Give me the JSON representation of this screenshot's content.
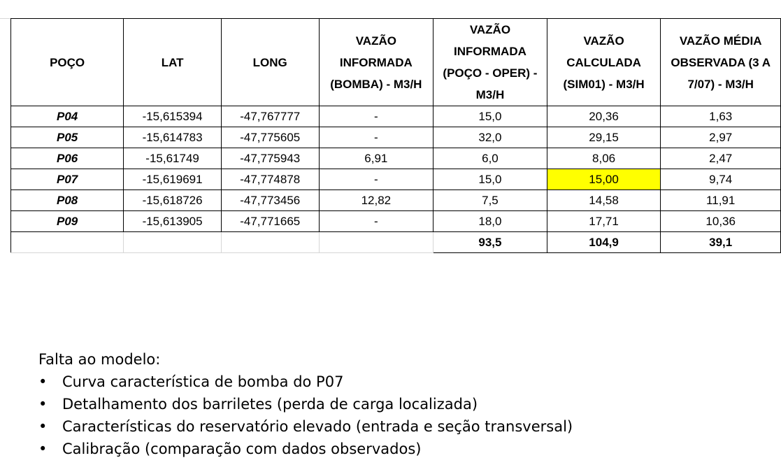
{
  "table": {
    "headers": [
      "POÇO",
      "LAT",
      "LONG",
      "VAZÃO INFORMADA (BOMBA) - M3/H",
      "VAZÃO INFORMADA (POÇO - OPER) - M3/H",
      "VAZÃO CALCULADA (SIM01) - M3/H",
      "VAZÃO MÉDIA OBSERVADA (3 A 7/07) - M3/H"
    ],
    "rows": [
      [
        "P04",
        "-15,615394",
        "-47,767777",
        "-",
        "15,0",
        "20,36",
        "1,63"
      ],
      [
        "P05",
        "-15,614783",
        "-47,775605",
        "-",
        "32,0",
        "29,15",
        "2,97"
      ],
      [
        "P06",
        "-15,61749",
        "-47,775943",
        "6,91",
        "6,0",
        "8,06",
        "2,47"
      ],
      [
        "P07",
        "-15,619691",
        "-47,774878",
        "-",
        "15,0",
        "15,00",
        "9,74"
      ],
      [
        "P08",
        "-15,618726",
        "-47,773456",
        "12,82",
        "7,5",
        "14,58",
        "11,91"
      ],
      [
        "P09",
        "-15,613905",
        "-47,771665",
        "-",
        "18,0",
        "17,71",
        "10,36"
      ]
    ],
    "totals": [
      "93,5",
      "104,9",
      "39,1"
    ],
    "highlight_color": "#ffff00"
  },
  "notes": {
    "title": "Falta ao modelo:",
    "bullet_glyph": "•",
    "items": [
      "Curva característica de bomba do P07",
      "Detalhamento dos barriletes (perda de carga localizada)",
      "Características do reservatório elevado (entrada e seção transversal)",
      "Calibração (comparação com dados observados)"
    ]
  }
}
